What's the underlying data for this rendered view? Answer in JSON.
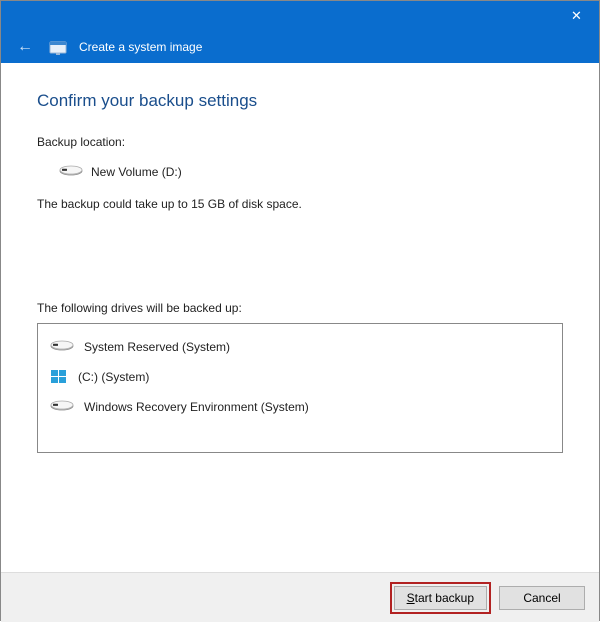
{
  "colors": {
    "accent": "#0a6dce",
    "highlight": "#b22222"
  },
  "titlebar": {
    "close_glyph": "✕"
  },
  "header": {
    "back_glyph": "←",
    "title": "Create a system image"
  },
  "page": {
    "heading": "Confirm your backup settings",
    "location_label": "Backup location:",
    "location_name": "New Volume (D:)",
    "size_note": "The backup could take up to 15 GB of disk space.",
    "drives_label": "The following drives will be backed up:",
    "drives": [
      {
        "icon": "disk",
        "label": "System Reserved (System)"
      },
      {
        "icon": "winlogo",
        "label": "(C:) (System)"
      },
      {
        "icon": "disk",
        "label": "Windows Recovery Environment (System)"
      }
    ]
  },
  "footer": {
    "start_label": "Start backup",
    "cancel_label": "Cancel"
  }
}
